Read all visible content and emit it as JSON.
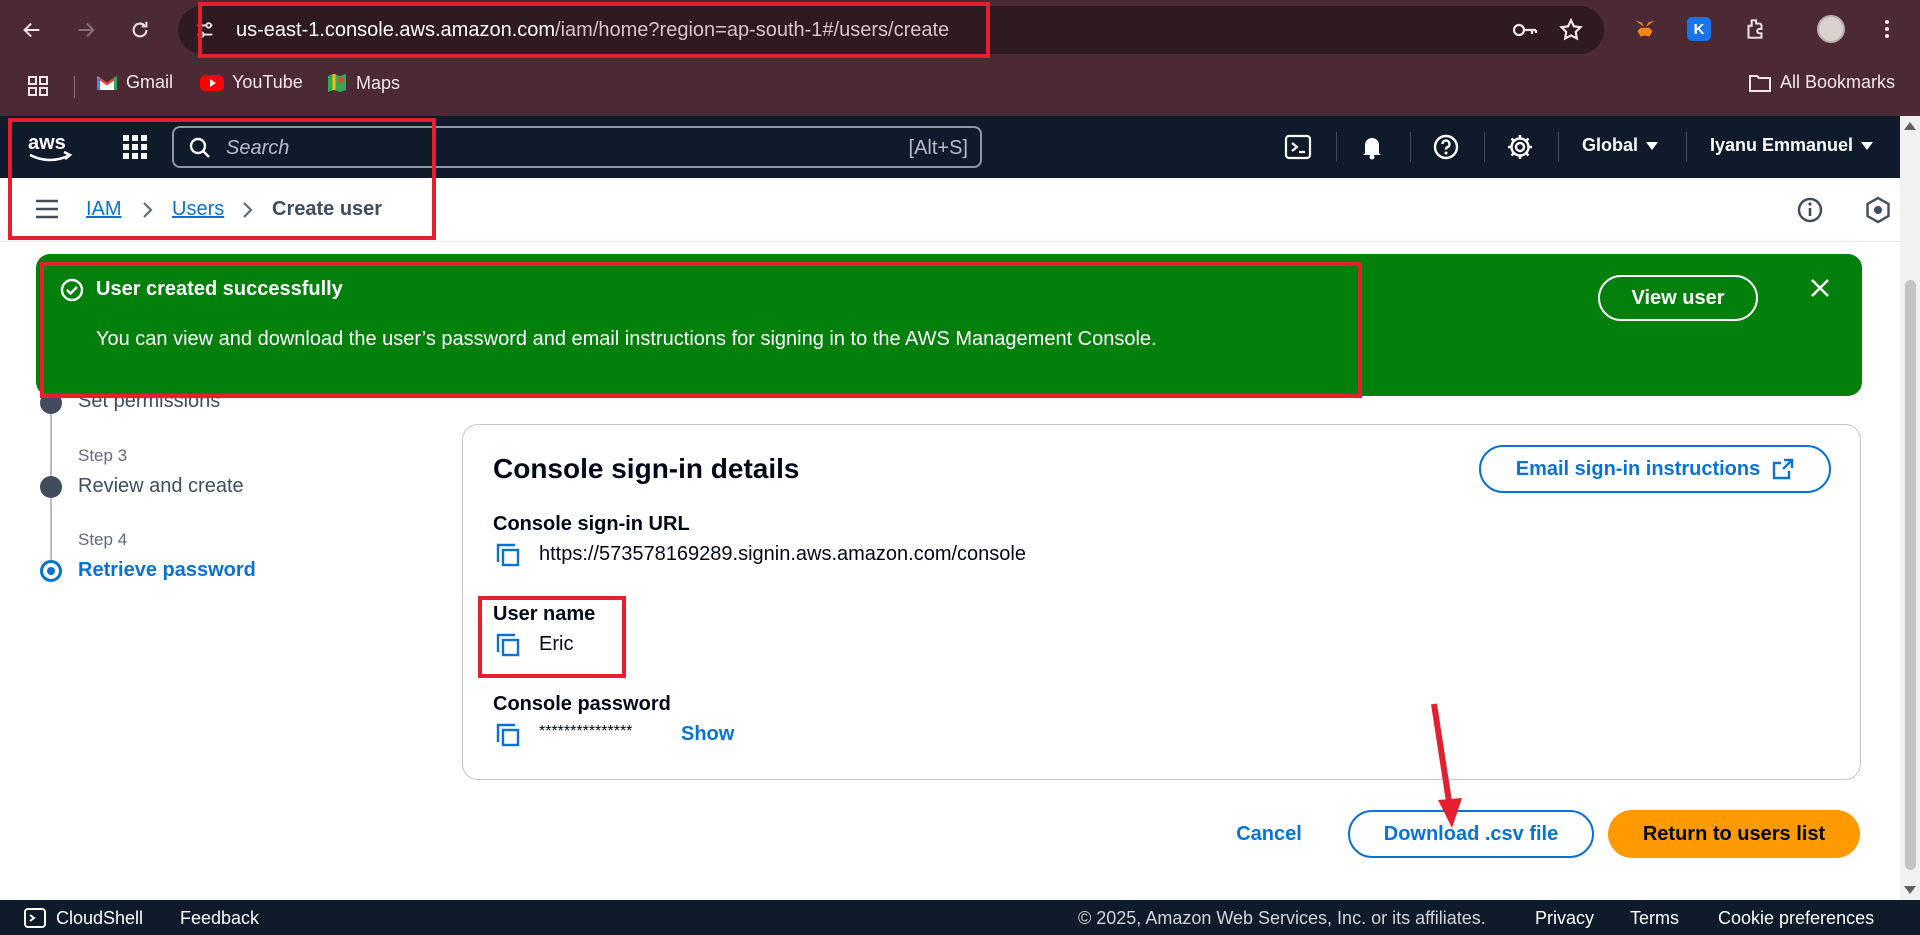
{
  "browser": {
    "url_host": "us-east-1.console.aws.amazon.com",
    "url_rest": "/iam/home?region=ap-south-1#/users/create",
    "bookmarks": [
      {
        "label": "Gmail",
        "icon": "gmail-icon"
      },
      {
        "label": "YouTube",
        "icon": "youtube-icon"
      },
      {
        "label": "Maps",
        "icon": "maps-icon"
      }
    ],
    "all_bookmarks": "All Bookmarks"
  },
  "awsnav": {
    "search_placeholder": "Search",
    "search_shortcut": "[Alt+S]",
    "region": "Global",
    "account": "Iyanu Emmanuel"
  },
  "breadcrumb": {
    "items": [
      "IAM",
      "Users",
      "Create user"
    ]
  },
  "steps": [
    {
      "num": "",
      "title": "Set permissions"
    },
    {
      "num": "Step 3",
      "title": "Review and create"
    },
    {
      "num": "Step 4",
      "title": "Retrieve password"
    }
  ],
  "flash": {
    "title": "User created successfully",
    "message": "You can view and download the user’s password and email instructions for signing in to the AWS Management Console.",
    "button": "View user",
    "color": "#037f0c"
  },
  "card": {
    "title": "Console sign-in details",
    "email_button": "Email sign-in instructions",
    "url_label": "Console sign-in URL",
    "url_value": "https://573578169289.signin.aws.amazon.com/console",
    "username_label": "User name",
    "username_value": "Eric",
    "password_label": "Console password",
    "password_value": "***************",
    "show_link": "Show"
  },
  "actions": {
    "cancel": "Cancel",
    "download": "Download .csv file",
    "return": "Return to users list",
    "primary_color": "#ff9900",
    "link_color": "#0972d3"
  },
  "footer": {
    "cloudshell": "CloudShell",
    "feedback": "Feedback",
    "copyright": "© 2025, Amazon Web Services, Inc. or its affiliates.",
    "privacy": "Privacy",
    "terms": "Terms",
    "cookies": "Cookie preferences"
  }
}
